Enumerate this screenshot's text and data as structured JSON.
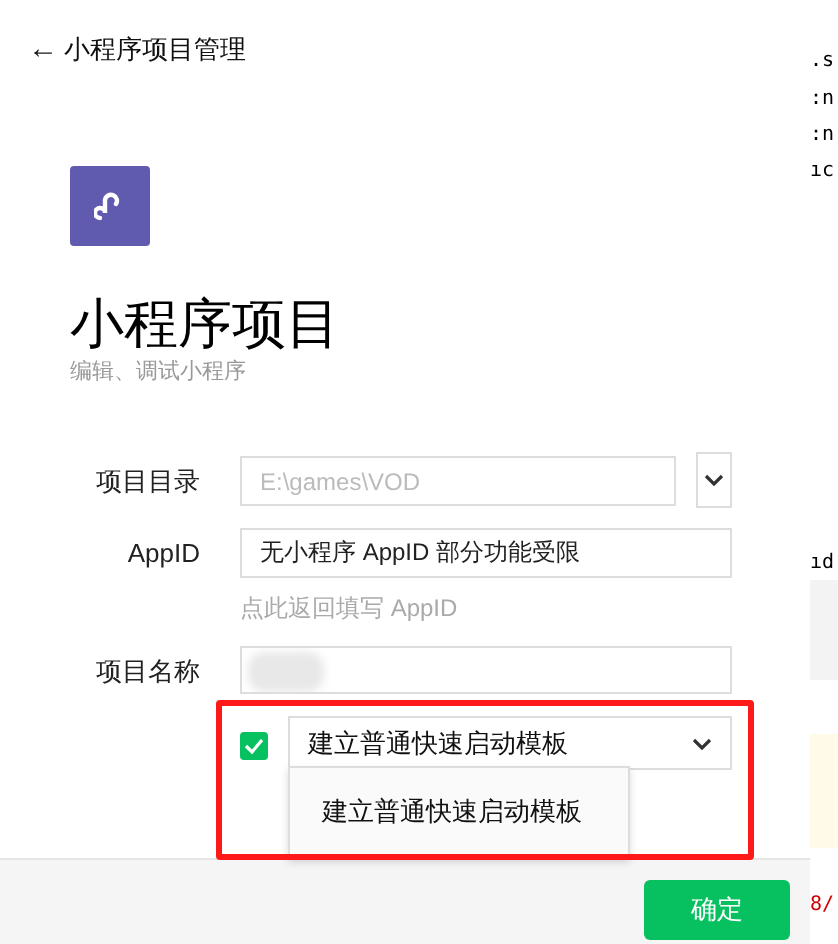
{
  "header": {
    "back_icon": "←",
    "title": "小程序项目管理"
  },
  "project": {
    "title": "小程序项目",
    "subtitle": "编辑、调试小程序"
  },
  "form": {
    "directory": {
      "label": "项目目录",
      "placeholder": "E:\\games\\VOD"
    },
    "appid": {
      "label": "AppID",
      "value": "无小程序 AppID 部分功能受限",
      "hint": "点此返回填写 AppID"
    },
    "name": {
      "label": "项目名称"
    },
    "template": {
      "checked": true,
      "value": "建立普通快速启动模板",
      "expanded": true,
      "options": [
        "建立普通快速启动模板"
      ]
    }
  },
  "footer": {
    "confirm": "确定"
  },
  "background_fragments": [
    {
      "text": ".s",
      "color": "#000000"
    },
    {
      "text": ":n",
      "color": "#000000"
    },
    {
      "text": ":n",
      "color": "#000000"
    },
    {
      "text": "ıc",
      "color": "#000000"
    },
    {
      "text": "ıd",
      "color": "#000000"
    },
    {
      "text": "8/",
      "color": "#cc0000"
    }
  ]
}
